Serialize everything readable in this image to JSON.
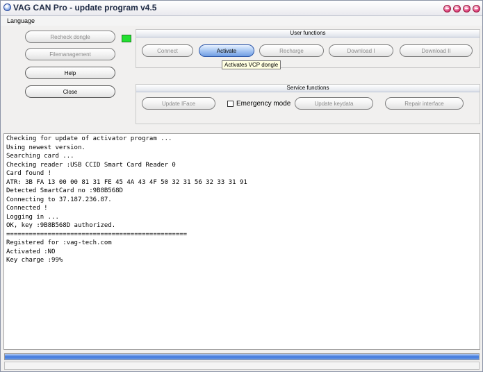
{
  "window": {
    "title": "VAG CAN Pro - update program v4.5"
  },
  "menu": {
    "items": [
      {
        "label": "Language"
      }
    ]
  },
  "left_buttons": {
    "recheck_dongle": "Recheck dongle",
    "filemanagement": "Filemanagement",
    "help": "Help",
    "close": "Close"
  },
  "dongle_indicator": {
    "color": "#22e030"
  },
  "user_functions": {
    "title": "User functions",
    "buttons": {
      "connect": "Connect",
      "activate": "Activate",
      "recharge": "Recharge",
      "download1": "Download I",
      "download2": "Download II"
    },
    "tooltip": "Activates VCP dongle"
  },
  "service_functions": {
    "title": "Service functions",
    "buttons": {
      "update_iface": "Update IFace",
      "update_keydata": "Update keydata",
      "repair_interface": "Repair interface"
    },
    "emergency_mode": {
      "label": "Emergency mode",
      "checked": false
    }
  },
  "log": {
    "lines": [
      "Checking for update of activator program ...",
      "Using newest version.",
      "Searching card ...",
      "Checking reader :USB CCID Smart Card Reader 0",
      "Card found !",
      "ATR: 3B FA 13 00 00 81 31 FE 45 4A 43 4F 50 32 31 56 32 33 31 91",
      "Detected SmartCard no :9B8B568D",
      "Connecting to 37.187.236.87.",
      "Connected !",
      "Logging in ...",
      "OK, key :9B8B568D authorized.",
      "================================================",
      "Registered for :vag-tech.com",
      "Activated :NO",
      "Key charge :99%"
    ]
  },
  "progress": {
    "value": 1.0,
    "color": "#3f78dc"
  }
}
